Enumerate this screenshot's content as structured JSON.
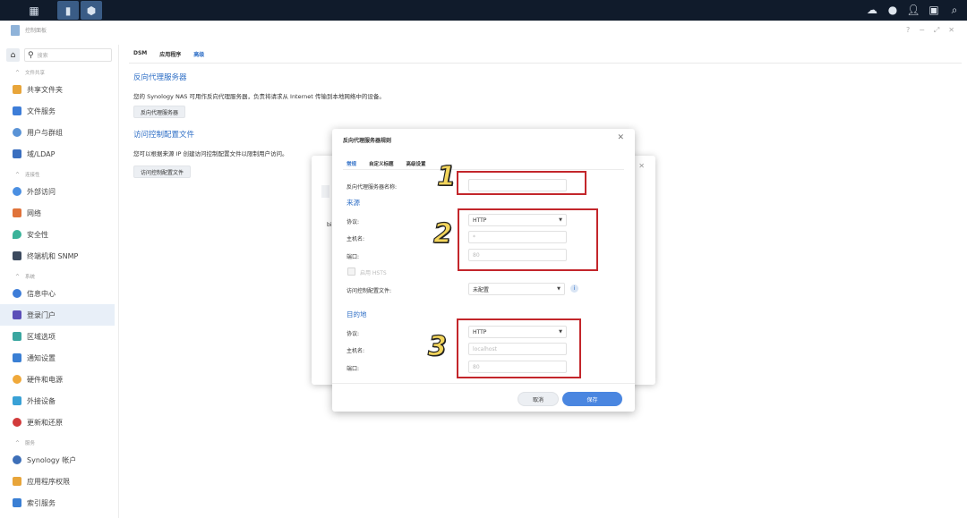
{
  "window": {
    "title": "控制面板",
    "app_icon": "control-panel-icon"
  },
  "taskbar": {
    "left_icons": [
      "grid-menu-icon",
      "control-panel-icon",
      "package-icon"
    ],
    "right_icons": [
      "cloud-sync-icon",
      "notification-icon",
      "user-icon",
      "widget-icon",
      "search-icon"
    ]
  },
  "window_controls": [
    "?",
    "−",
    "⤢",
    "✕"
  ],
  "sidebar": {
    "search_placeholder": "搜索",
    "sections": [
      {
        "label": "文件共享",
        "items": [
          "共享文件夹",
          "文件服务",
          "用户与群组",
          "域/LDAP"
        ]
      },
      {
        "label": "连接性",
        "items": [
          "外部访问",
          "网络",
          "安全性",
          "终端机和 SNMP"
        ]
      },
      {
        "label": "系统",
        "items": [
          "信息中心",
          "登录门户",
          "区域选项",
          "通知设置",
          "硬件和电源",
          "外接设备",
          "更新和还原"
        ]
      },
      {
        "label": "服务",
        "items": [
          "Synology 帐户",
          "应用程序权限",
          "索引服务"
        ]
      }
    ],
    "selected": "登录门户"
  },
  "main": {
    "tabs": [
      "DSM",
      "应用程序",
      "高级"
    ],
    "active_tab": "高级",
    "rp_title": "反向代理服务器",
    "rp_desc": "您的 Synology NAS 可用作反向代理服务器，负责将请求从 Internet 传输到本地网络中的设备。",
    "rp_button": "反向代理服务器",
    "acp_title": "访问控制配置文件",
    "acp_desc": "您可以根据来源 IP 创建访问控制配置文件以限制用户访问。",
    "acp_button": "访问控制配置文件"
  },
  "back_dialog": {
    "stub_text": "bi"
  },
  "dialog": {
    "title": "反向代理服务器规则",
    "tabs": [
      "常规",
      "自定义标题",
      "高级设置"
    ],
    "active_tab": "常规",
    "name_label": "反向代理服务器名称:",
    "name_value": "",
    "source_title": "来源",
    "source": {
      "protocol_label": "协议:",
      "protocol_value": "HTTP",
      "hostname_label": "主机名:",
      "hostname_placeholder": "*",
      "port_label": "端口:",
      "port_placeholder": "80",
      "hsts_label": "启用 HSTS",
      "acp_label": "访问控制配置文件:",
      "acp_value": "未配置"
    },
    "dest_title": "目的地",
    "dest": {
      "protocol_label": "协议:",
      "protocol_value": "HTTP",
      "hostname_label": "主机名:",
      "hostname_placeholder": "localhost",
      "port_label": "端口:",
      "port_placeholder": "80"
    },
    "cancel": "取消",
    "save": "保存"
  },
  "annotations": [
    "1",
    "2",
    "3"
  ],
  "colors": {
    "accent": "#2f6fc6",
    "save": "#4a86e0",
    "annotation_box": "#c3262b",
    "annotation_number": "#f3d55b",
    "taskbar": "#101b2b"
  }
}
